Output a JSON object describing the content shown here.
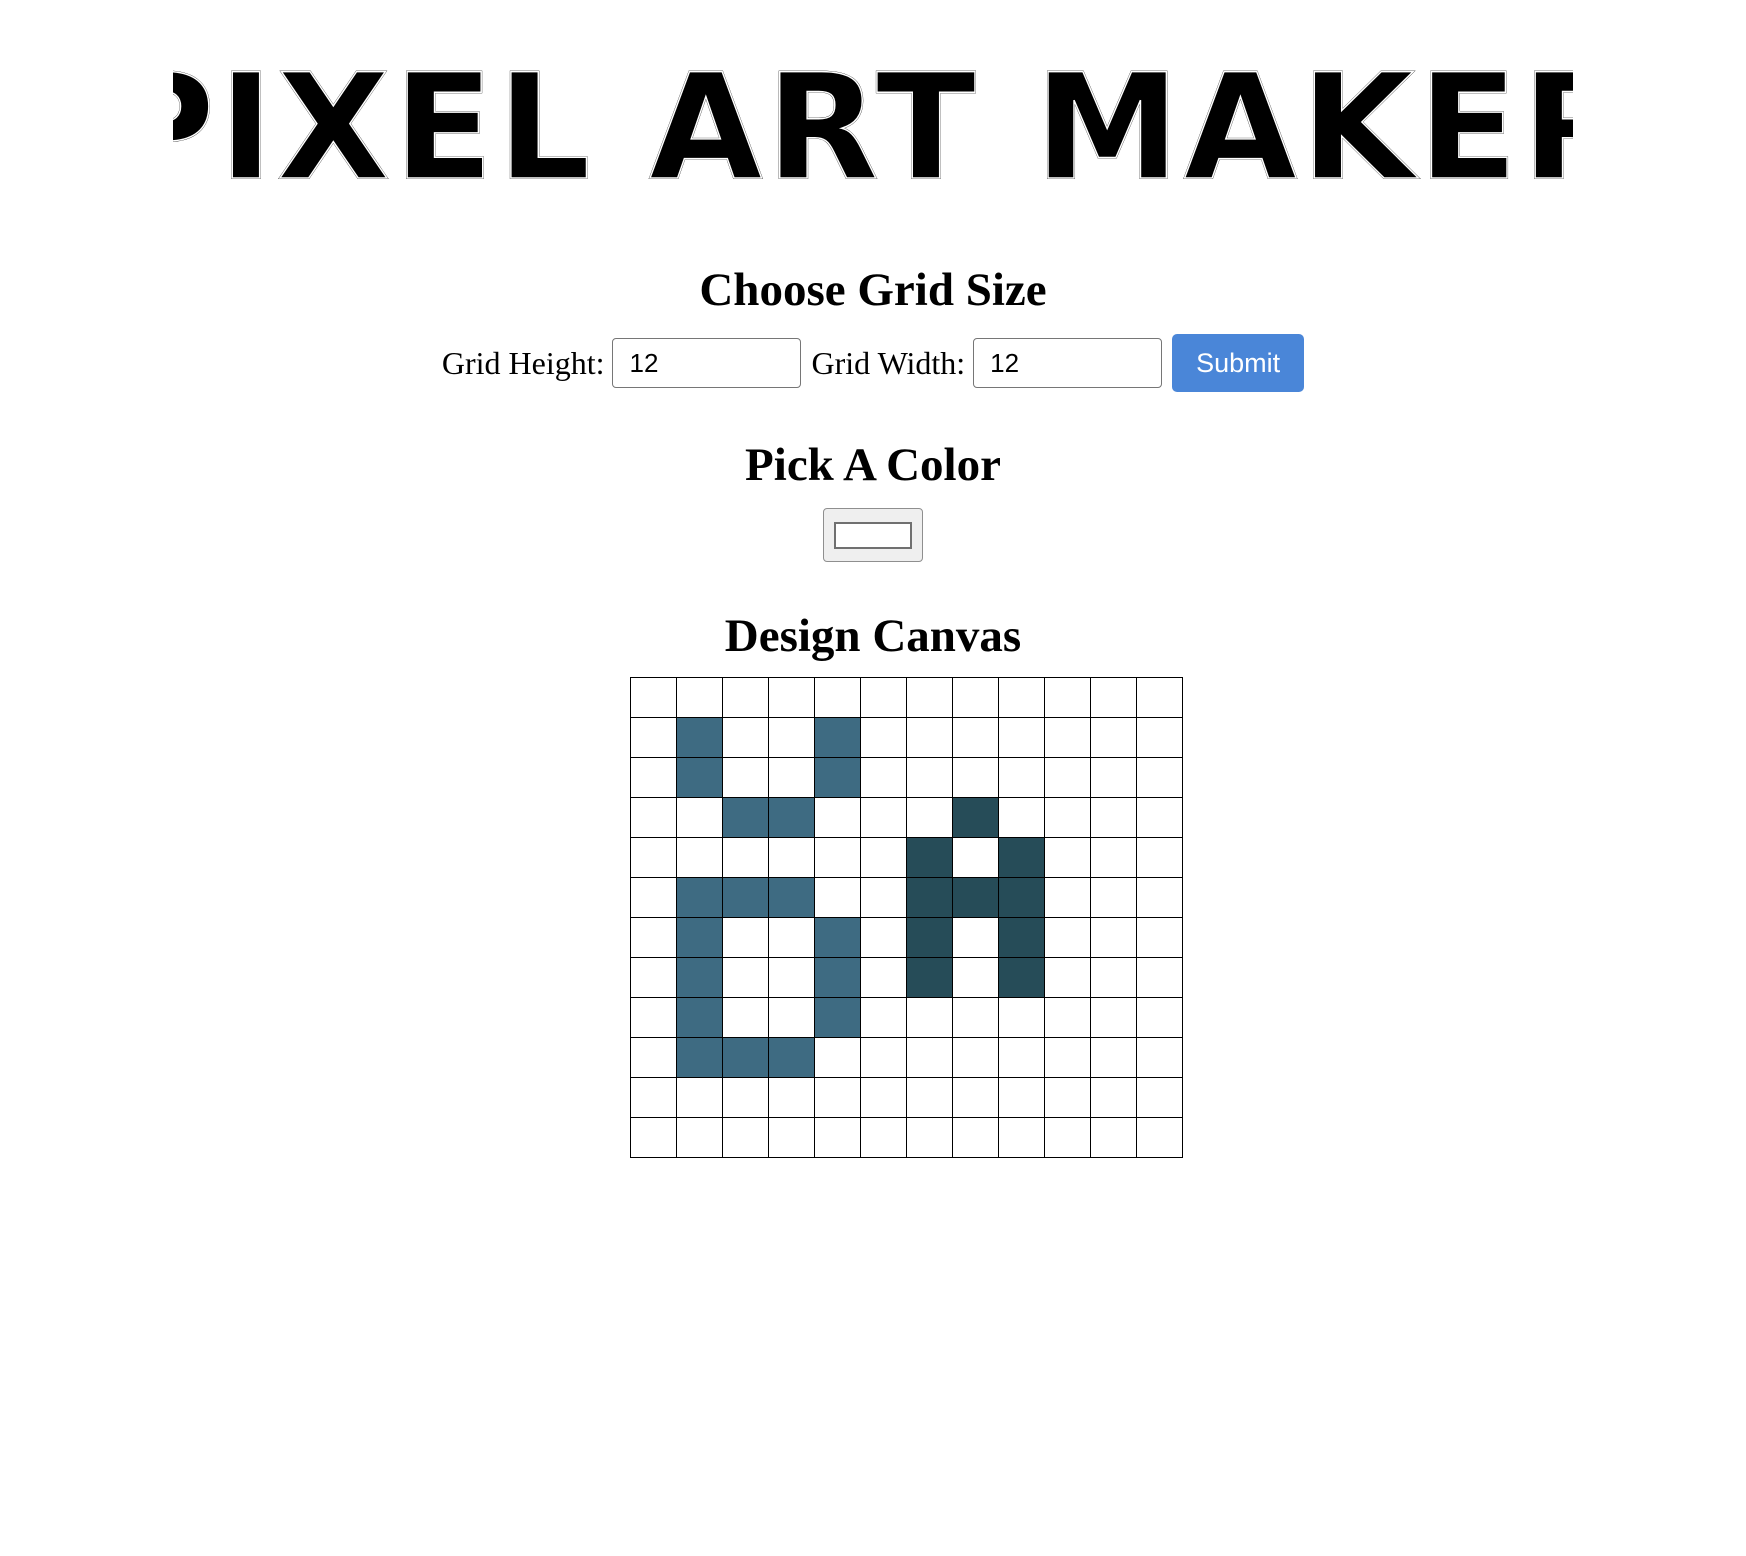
{
  "logo": {
    "text": "PIXEL ART MAKER"
  },
  "grid_size_section": {
    "heading": "Choose Grid Size",
    "height_label": "Grid Height:",
    "height_value": "12",
    "width_label": "Grid Width:",
    "width_value": "12",
    "submit_label": "Submit"
  },
  "color_section": {
    "heading": "Pick A Color",
    "selected_color": "#ffffff"
  },
  "canvas_section": {
    "heading": "Design Canvas",
    "rows": 12,
    "cols": 12,
    "palette": {
      "W": "#ffffff",
      "A": "#3e6b82",
      "B": "#264c58"
    },
    "cells": [
      "WWWWWWWWWWWW",
      "WAWWAWWWWWWW",
      "WAWWAWWWWWWW",
      "WWAAWWWBWWWW",
      "WWWWWWBWBWWW",
      "WAAAWWBBBWWW",
      "WAWWAWBWBWWW",
      "WAWWAWBWBWWW",
      "WAWWAWWWWWWW",
      "WAAAWWWWWWWW",
      "WWWWWWWWWWWW",
      "WWWWWWWWWWWW"
    ]
  }
}
